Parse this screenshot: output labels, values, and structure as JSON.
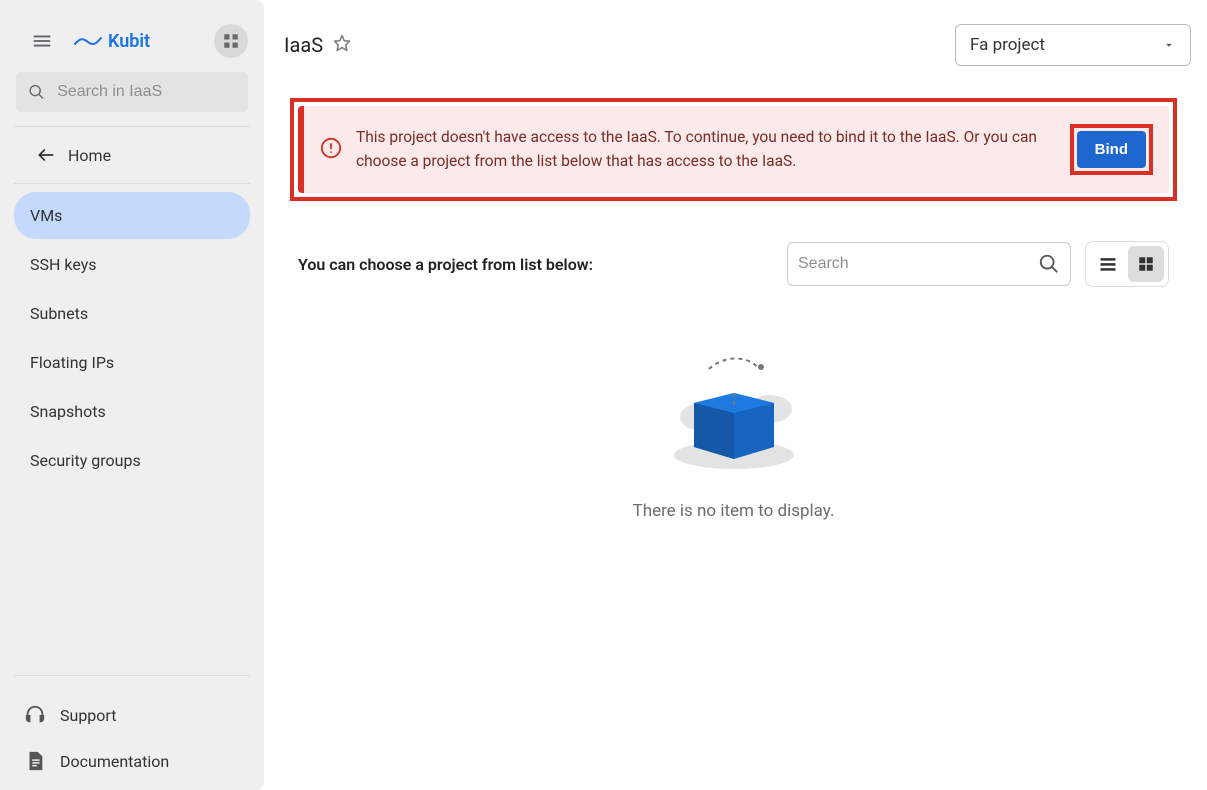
{
  "brand": "Kubit",
  "search": {
    "placeholder": "Search in IaaS"
  },
  "nav": {
    "home": "Home",
    "items": [
      {
        "label": "VMs",
        "active": true
      },
      {
        "label": "SSH keys",
        "active": false
      },
      {
        "label": "Subnets",
        "active": false
      },
      {
        "label": "Floating IPs",
        "active": false
      },
      {
        "label": "Snapshots",
        "active": false
      },
      {
        "label": "Security groups",
        "active": false
      }
    ]
  },
  "bottom": {
    "support": "Support",
    "docs": "Documentation"
  },
  "header": {
    "breadcrumb": "IaaS",
    "project_selected": "Fa project"
  },
  "alert": {
    "text": "This project doesn't have access to the IaaS. To continue, you need to bind it to the IaaS. Or you can choose a project from the list below that has access to the IaaS.",
    "bind_label": "Bind"
  },
  "listing": {
    "title": "You can choose a project from list below:",
    "search_placeholder": "Search",
    "empty_text": "There is no item to display."
  }
}
